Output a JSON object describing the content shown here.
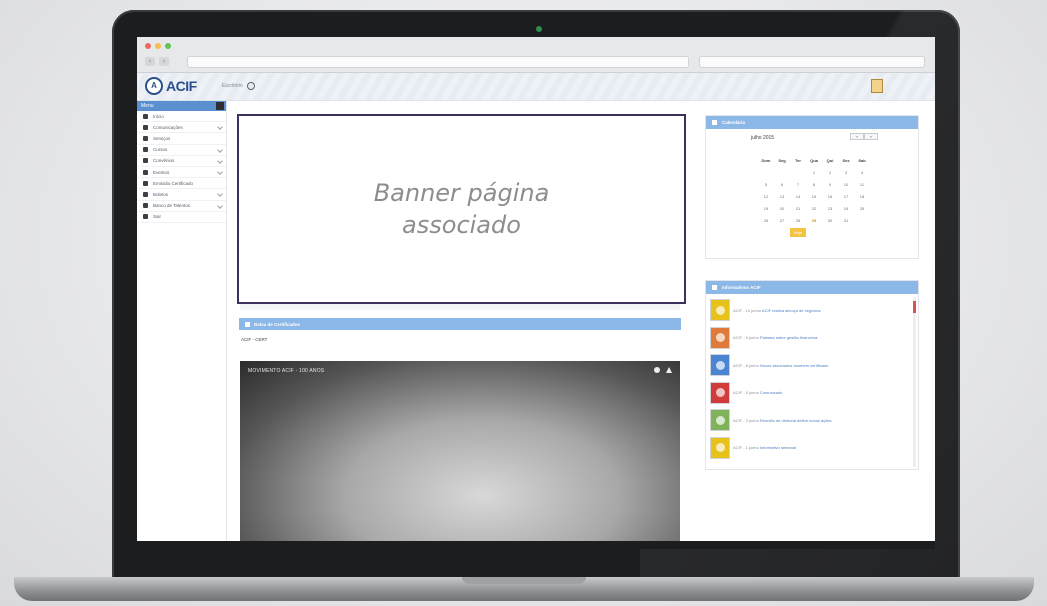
{
  "app": {
    "logo_text": "ACIF",
    "breadcrumb": "Escritório"
  },
  "sidebar": {
    "header_label": "Menu",
    "items": [
      {
        "label": "Início",
        "icon": "home-icon",
        "has_chevron": false
      },
      {
        "label": "Comunicações",
        "icon": "wrench-icon",
        "has_chevron": true
      },
      {
        "label": "Serviços",
        "icon": "grid-icon",
        "has_chevron": false
      },
      {
        "label": "Cursos",
        "icon": "home-icon",
        "has_chevron": true
      },
      {
        "label": "Convênios",
        "icon": "grid-icon",
        "has_chevron": true
      },
      {
        "label": "Eventos",
        "icon": "lock-icon",
        "has_chevron": true
      },
      {
        "label": "Emissão Certificado",
        "icon": "grid-icon",
        "has_chevron": false
      },
      {
        "label": "Boletos",
        "icon": "chart-icon",
        "has_chevron": true
      },
      {
        "label": "Banco de Talentos",
        "icon": "folder-icon",
        "has_chevron": true
      },
      {
        "label": "Sair",
        "icon": "doc-icon",
        "has_chevron": false
      }
    ]
  },
  "banner": {
    "text": "Banner página\nassociado"
  },
  "main": {
    "panel_title": "Bolsa de Certificados",
    "section_label": "ACIF - CERT",
    "video_title": "MOVIMENTO ACIF - 100 ANOS"
  },
  "calendar": {
    "title": "Calendário",
    "month": "julho 2015",
    "nav_prev": "‹‹",
    "nav_next": "››",
    "weekdays": [
      "Dom",
      "Seg",
      "Ter",
      "Qua",
      "Qui",
      "Sex",
      "Sab"
    ],
    "days": [
      "",
      "",
      "",
      "1",
      "2",
      "3",
      "4",
      "5",
      "6",
      "7",
      "8",
      "9",
      "10",
      "11",
      "12",
      "13",
      "14",
      "15",
      "16",
      "17",
      "18",
      "19",
      "20",
      "21",
      "22",
      "23",
      "24",
      "25",
      "26",
      "27",
      "28",
      "29",
      "30",
      "31",
      ""
    ],
    "today_label": "Hoje"
  },
  "notices": {
    "title": "Informativos ACIF",
    "items": [
      {
        "color": "#e7c21a",
        "text": "ACIF - 10 junho",
        "link": "ACIF realiza almoço de negócios"
      },
      {
        "color": "#e07a3a",
        "text": "ACIF - 9 junho",
        "link": "Palestra sobre gestão financeira"
      },
      {
        "color": "#4a85d4",
        "text": "ACIF - 8 junho",
        "link": "Novos associados recebem certificado"
      },
      {
        "color": "#d13b3b",
        "text": "ACIF - 5 junho",
        "link": "Comunicado"
      },
      {
        "color": "#7fb35a",
        "text": "ACIF - 3 junho",
        "link": "Reunião de diretoria define novas ações"
      },
      {
        "color": "#e7c21a",
        "text": "ACIF - 1 junho",
        "link": "Informativo semanal"
      }
    ]
  }
}
